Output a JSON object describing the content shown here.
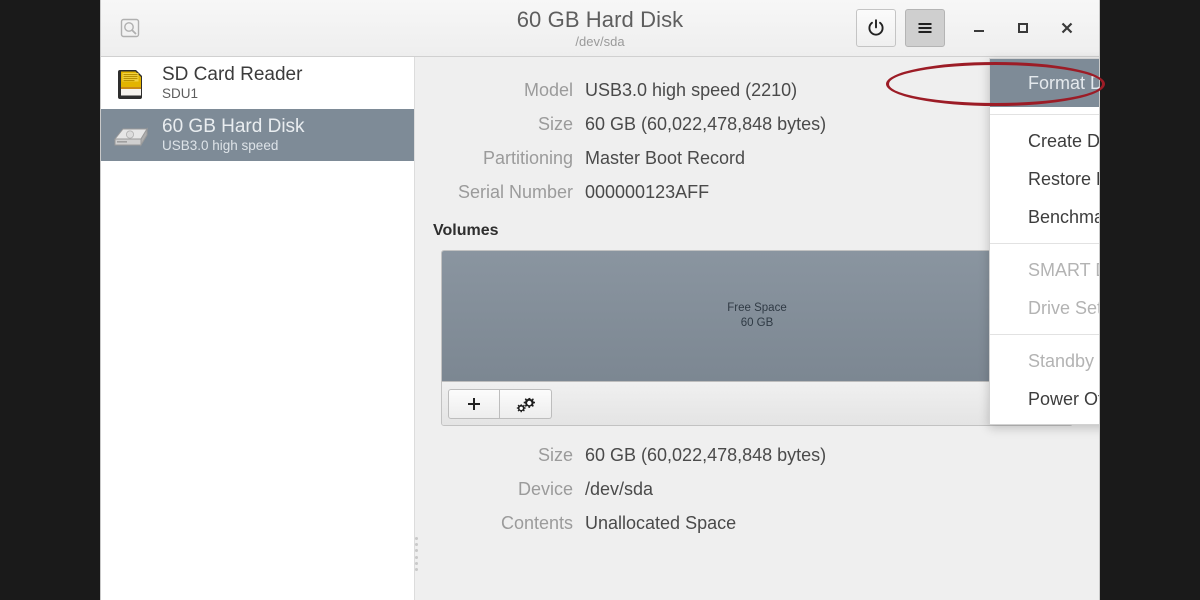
{
  "window": {
    "title": "60 GB Hard Disk",
    "subtitle": "/dev/sda",
    "image_button_icon": "disk-image-icon",
    "power_button_icon": "power-icon",
    "menu_button_icon": "hamburger-menu-icon",
    "minimize_icon": "minimize-icon",
    "maximize_icon": "maximize-icon",
    "close_icon": "close-icon"
  },
  "sidebar": {
    "devices": [
      {
        "name": "SD Card Reader",
        "subtitle": "SDU1",
        "icon": "sd-card-icon",
        "selected": false
      },
      {
        "name": "60 GB Hard Disk",
        "subtitle": "USB3.0 high speed",
        "icon": "hard-disk-icon",
        "selected": true
      }
    ]
  },
  "details": {
    "fields": [
      {
        "label": "Model",
        "value": "USB3.0 high speed (2210)"
      },
      {
        "label": "Size",
        "value": "60 GB (60,022,478,848 bytes)"
      },
      {
        "label": "Partitioning",
        "value": "Master Boot Record"
      },
      {
        "label": "Serial Number",
        "value": "000000123AFF"
      }
    ]
  },
  "volumes": {
    "section_title": "Volumes",
    "partition": {
      "name": "Free Space",
      "size": "60 GB",
      "color": "#828d99"
    },
    "toolbar": {
      "add_icon": "plus-icon",
      "add_label": "+",
      "settings_icon": "gears-icon"
    },
    "fields": [
      {
        "label": "Size",
        "value": "60 GB (60,022,478,848 bytes)"
      },
      {
        "label": "Device",
        "value": "/dev/sda"
      },
      {
        "label": "Contents",
        "value": "Unallocated Space"
      }
    ]
  },
  "menu": {
    "items": [
      {
        "label": "Format Disk…",
        "state": "selected"
      },
      {
        "separator": true
      },
      {
        "label": "Create Disk Image…",
        "state": "enabled"
      },
      {
        "label": "Restore Disk Image…",
        "state": "enabled"
      },
      {
        "label": "Benchmark Disk…",
        "state": "enabled"
      },
      {
        "separator": true
      },
      {
        "label": "SMART Data & Self-Tests…",
        "state": "disabled"
      },
      {
        "label": "Drive Settings…",
        "state": "disabled"
      },
      {
        "separator": true
      },
      {
        "label": "Standby Now",
        "state": "disabled"
      },
      {
        "label": "Power Off…",
        "state": "enabled"
      }
    ]
  },
  "annotation": {
    "shape": "ellipse-highlight",
    "color": "#9c1c26",
    "target": "Format Disk…"
  }
}
